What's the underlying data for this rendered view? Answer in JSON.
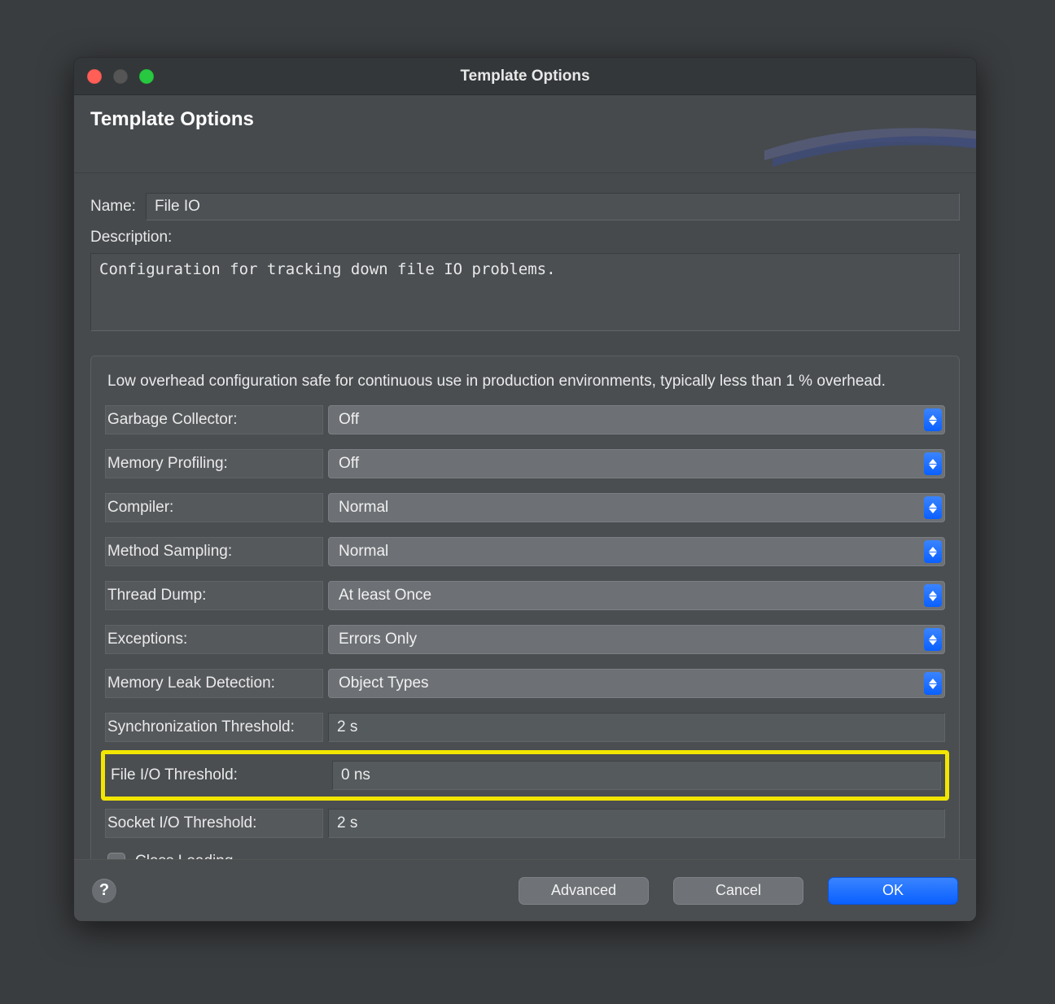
{
  "window": {
    "title": "Template Options",
    "subtitle": "Template Options"
  },
  "form": {
    "name_label": "Name:",
    "name_value": "File IO",
    "description_label": "Description:",
    "description_value": "Configuration for tracking down file IO problems."
  },
  "panel": {
    "note": "Low overhead configuration safe for continuous use in production environments, typically less than 1 % overhead.",
    "rows": {
      "gc": {
        "label": "Garbage Collector:",
        "value": "Off",
        "type": "select"
      },
      "mem": {
        "label": "Memory Profiling:",
        "value": "Off",
        "type": "select"
      },
      "comp": {
        "label": "Compiler:",
        "value": "Normal",
        "type": "select"
      },
      "samp": {
        "label": "Method Sampling:",
        "value": "Normal",
        "type": "select"
      },
      "thread": {
        "label": "Thread Dump:",
        "value": "At least Once",
        "type": "select"
      },
      "exc": {
        "label": "Exceptions:",
        "value": "Errors Only",
        "type": "select"
      },
      "leak": {
        "label": "Memory Leak Detection:",
        "value": "Object Types",
        "type": "select"
      },
      "sync": {
        "label": "Synchronization Threshold:",
        "value": "2 s",
        "type": "text"
      },
      "fio": {
        "label": "File I/O Threshold:",
        "value": "0 ns",
        "type": "text",
        "highlighted": true
      },
      "sio": {
        "label": "Socket I/O Threshold:",
        "value": "2 s",
        "type": "text"
      }
    },
    "class_loading_label": "Class Loading",
    "class_loading_checked": false
  },
  "footer": {
    "help": "?",
    "advanced": "Advanced",
    "cancel": "Cancel",
    "ok": "OK"
  }
}
